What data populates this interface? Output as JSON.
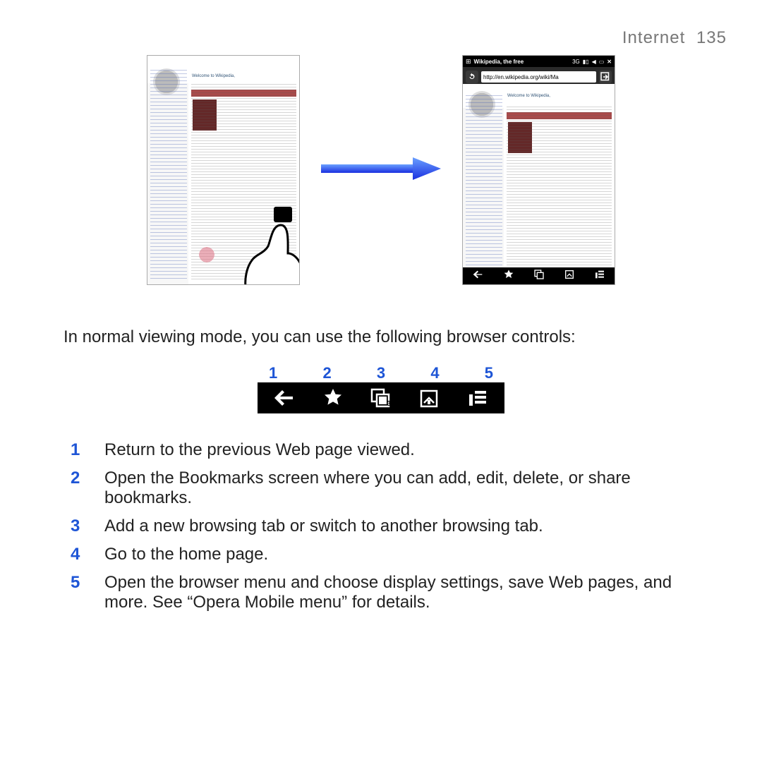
{
  "header": {
    "section": "Internet",
    "page_number": "135"
  },
  "screenshots": {
    "left": {
      "welcome": "Welcome to Wikipedia,"
    },
    "right": {
      "topbar_site": "Wikipedia, the free",
      "url": "http://en.wikipedia.org/wiki/Ma",
      "welcome": "Welcome to Wikipedia,"
    }
  },
  "caption": "In normal viewing mode, you can use the following browser controls:",
  "toolbar_numbers": [
    "1",
    "2",
    "3",
    "4",
    "5"
  ],
  "toolbar_tabs_badge": "3",
  "legend": [
    {
      "n": "1",
      "text": "Return to the previous Web page viewed."
    },
    {
      "n": "2",
      "text": "Open the Bookmarks screen where you can add, edit, delete, or share bookmarks."
    },
    {
      "n": "3",
      "text": "Add a new browsing tab or switch to another browsing tab."
    },
    {
      "n": "4",
      "text": "Go to the home page."
    },
    {
      "n": "5",
      "text": "Open the browser menu and choose display settings, save Web pages, and more. See “Opera Mobile menu” for details."
    }
  ]
}
